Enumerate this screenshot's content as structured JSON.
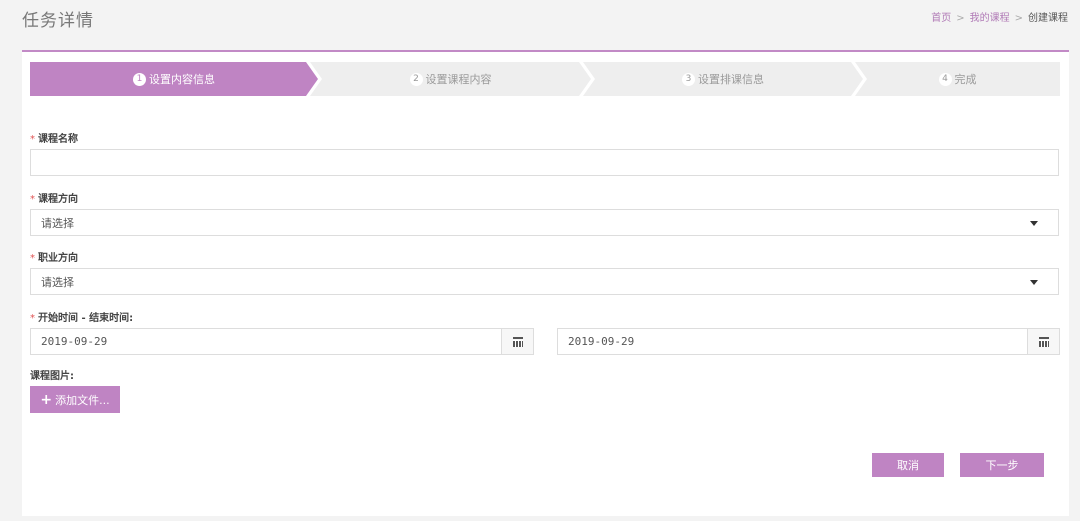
{
  "header": {
    "title": "任务详情",
    "breadcrumb": [
      "首页",
      "我的课程",
      "创建课程"
    ],
    "breadcrumb_sep": ">"
  },
  "steps": [
    {
      "num": "1",
      "label": "设置内容信息",
      "active": true
    },
    {
      "num": "2",
      "label": "设置课程内容",
      "active": false
    },
    {
      "num": "3",
      "label": "设置排课信息",
      "active": false
    },
    {
      "num": "4",
      "label": "完成",
      "active": false
    }
  ],
  "form": {
    "required_mark": "*",
    "course_name": {
      "label": "课程名称",
      "value": ""
    },
    "course_direction": {
      "label": "课程方向",
      "value": "请选择"
    },
    "career_direction": {
      "label": "职业方向",
      "value": "请选择"
    },
    "time_range": {
      "label": "开始时间 - 结束时间:",
      "start": "2019-09-29",
      "end": "2019-09-29"
    },
    "course_image": {
      "label": "课程图片:",
      "button": "添加文件..."
    }
  },
  "actions": {
    "cancel": "取消",
    "next": "下一步"
  },
  "colors": {
    "accent": "#bf84c3",
    "required": "#e05555",
    "step_inactive": "#eeeeee"
  }
}
